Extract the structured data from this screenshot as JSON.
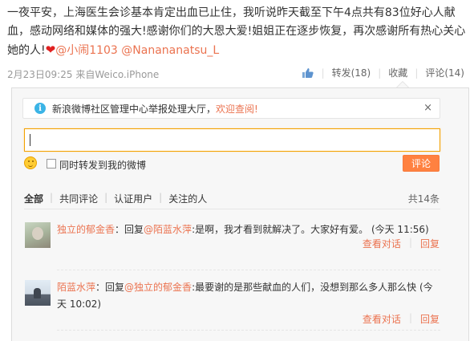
{
  "post": {
    "text": "一夜平安，上海医生会诊基本肯定出血已止住，我听说昨天截至下午4点共有83位好心人献血，感动网络和媒体的强大!感谢你们的大恩大爱!姐姐正在逐步恢复，再次感谢所有热心关心她的人!",
    "heart_icon": "heart-icon",
    "mention1": "@小闹1103",
    "mention2": "@Nanananatsu_L",
    "date": "2月23日09:25",
    "from_label": "来自",
    "source": "Weico.iPhone"
  },
  "actions": {
    "like_icon": "thumbs-up-icon",
    "repost": "转发(18)",
    "favorite": "收藏",
    "comment": "评论(14)"
  },
  "notice": {
    "icon": "info-icon",
    "text": "新浪微博社区管理中心举报处理大厅，",
    "link": "欢迎查阅!",
    "close": "×"
  },
  "compose": {
    "input_value": "",
    "forward_label": "同时转发到我的微博",
    "submit": "评论"
  },
  "filters": {
    "all": "全部",
    "mutual": "共同评论",
    "verified": "认证用户",
    "following": "关注的人",
    "total": "共14条"
  },
  "comments": [
    {
      "name": "独立的郁金香",
      "sep": "：",
      "reply_prefix": "回复",
      "reply_to": "@陌蓝水萍",
      "body": ":是啊，我才看到就解决了。大家好有爱。",
      "time": "(今天 11:56)",
      "view_conversation": "查看对话",
      "reply": "回复"
    },
    {
      "name": "陌蓝水萍",
      "sep": "：",
      "reply_prefix": "回复",
      "reply_to": "@独立的郁金香",
      "body": ":最要谢的是那些献血的人们，没想到那么多人那么快",
      "time": "(今天 10:02)",
      "view_conversation": "查看对话",
      "reply": "回复"
    }
  ],
  "colors": {
    "link": "#eb7350",
    "button": "#ff8140",
    "info": "#3bb4e6"
  }
}
